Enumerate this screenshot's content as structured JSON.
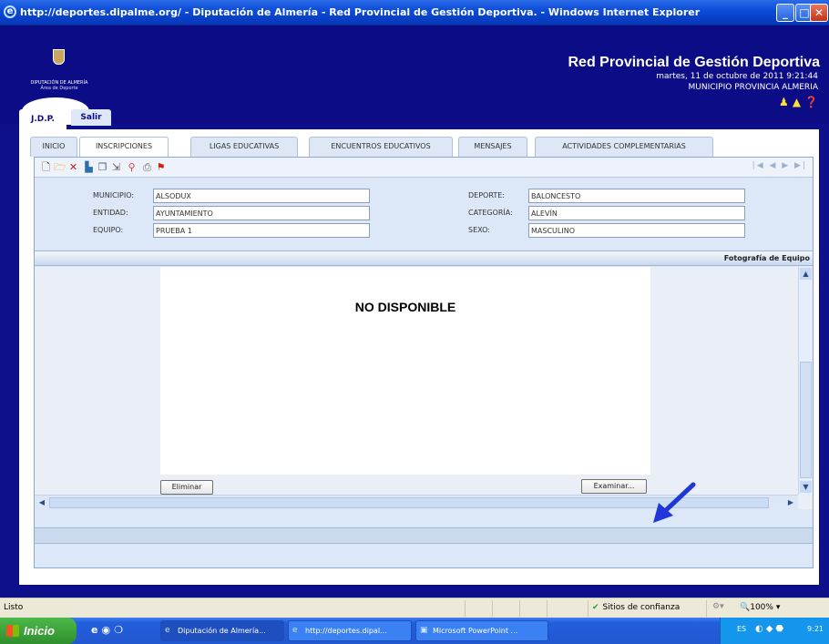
{
  "window": {
    "title": "http://deportes.dipalme.org/ - Diputación de Almería - Red Provincial de Gestión Deportiva. - Windows Internet Explorer",
    "min_icon": "minimize-icon",
    "max_icon": "maximize-icon",
    "close_icon": "close-icon"
  },
  "header": {
    "logo_line1": "DIPUTACIÓN DE ALMERÍA",
    "logo_line2": "Área de Deporte",
    "title": "Red Provincial de Gestión Deportiva",
    "datetime": "martes, 11 de octubre de 2011 9:21:44",
    "municipio": "MUNICIPIO PROVINCIA ALMERIA",
    "icons": [
      "users-icon",
      "warning-icon",
      "help-icon"
    ]
  },
  "top_tabs": {
    "jdp": "J.D.P.",
    "salir": "Salir"
  },
  "tabs": [
    "INICIO",
    "INSCRIPCIONES",
    "LIGAS EDUCATIVAS",
    "ENCUENTROS EDUCATIVOS",
    "MENSAJES",
    "ACTIVIDADES COMPLEMENTARIAS"
  ],
  "active_tab": "INSCRIPCIONES",
  "toolbar": {
    "icons": [
      "new-icon",
      "open-icon",
      "delete-icon",
      "save-icon",
      "copy-icon",
      "export-icon",
      "search-users-icon",
      "print-icon",
      "pdf-icon"
    ],
    "nav": "|◀ ◀ ▶ ▶|"
  },
  "form": {
    "municipio_label": "MUNICIPIO:",
    "municipio_value": "ALSODUX",
    "entidad_label": "ENTIDAD:",
    "entidad_value": "AYUNTAMIENTO",
    "equipo_label": "EQUIPO:",
    "equipo_value": "PRUEBA 1",
    "deporte_label": "DEPORTE:",
    "deporte_value": "BALONCESTO",
    "categoria_label": "CATEGORÍA:",
    "categoria_value": "ALEVÍN",
    "sexo_label": "SEXO:",
    "sexo_value": "MASCULINO"
  },
  "photo": {
    "section_title": "Fotografía de Equipo",
    "placeholder": "NO DISPONIBLE",
    "delete_button": "Eliminar",
    "browse_button": "Examinar..."
  },
  "statusbar": {
    "status": "Listo",
    "zone": "Sitios de confianza",
    "zoom": "100%"
  },
  "taskbar": {
    "start": "Inicio",
    "tasks": [
      "Diputación de Almería...",
      "http://deportes.dipal...",
      "Microsoft PowerPoint ..."
    ],
    "lang": "ES",
    "clock": "9:21"
  },
  "colors": {
    "header_bg": "#0c0d86",
    "panel_bg": "#dce8f8",
    "arrow": "#1f37d8"
  }
}
